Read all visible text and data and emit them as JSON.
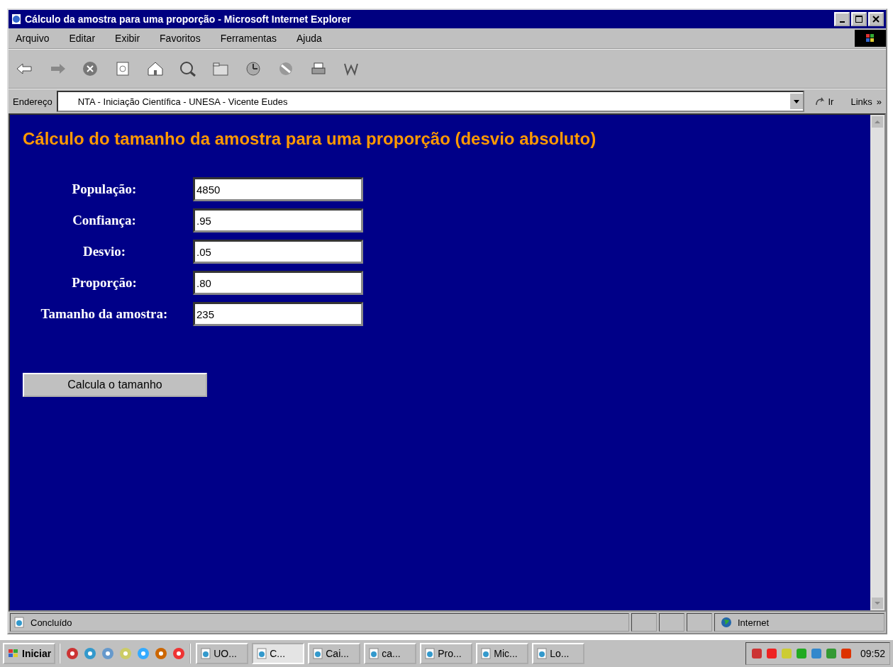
{
  "window": {
    "title": "Cálculo da amostra para uma proporção - Microsoft Internet Explorer"
  },
  "menu": [
    "Arquivo",
    "Editar",
    "Exibir",
    "Favoritos",
    "Ferramentas",
    "Ajuda"
  ],
  "address": {
    "label": "Endereço",
    "value": "NTA - Iniciação Científica - UNESA - Vicente Eudes",
    "go": "Ir",
    "links": "Links",
    "more": "»"
  },
  "page": {
    "title": "Cálculo do tamanho da amostra para uma proporção (desvio absoluto)",
    "fields": [
      {
        "label": "População:",
        "value": "4850"
      },
      {
        "label": "Confiança:",
        "value": ".95"
      },
      {
        "label": "Desvio:",
        "value": ".05"
      },
      {
        "label": "Proporção:",
        "value": ".80"
      },
      {
        "label": "Tamanho da amostra:",
        "value": "235"
      }
    ],
    "button": "Calcula o tamanho"
  },
  "status_bar": {
    "text": "Concluído",
    "zone": "Internet"
  },
  "taskbar": {
    "start": "Iniciar",
    "clock": "09:52",
    "buttons": [
      {
        "label": "UO...",
        "selected": false
      },
      {
        "label": "C...",
        "selected": true
      },
      {
        "label": "Cai...",
        "selected": false
      },
      {
        "label": "ca...",
        "selected": false
      },
      {
        "label": "Pro...",
        "selected": false
      },
      {
        "label": "Mic...",
        "selected": false
      },
      {
        "label": "Lo...",
        "selected": false
      }
    ]
  }
}
